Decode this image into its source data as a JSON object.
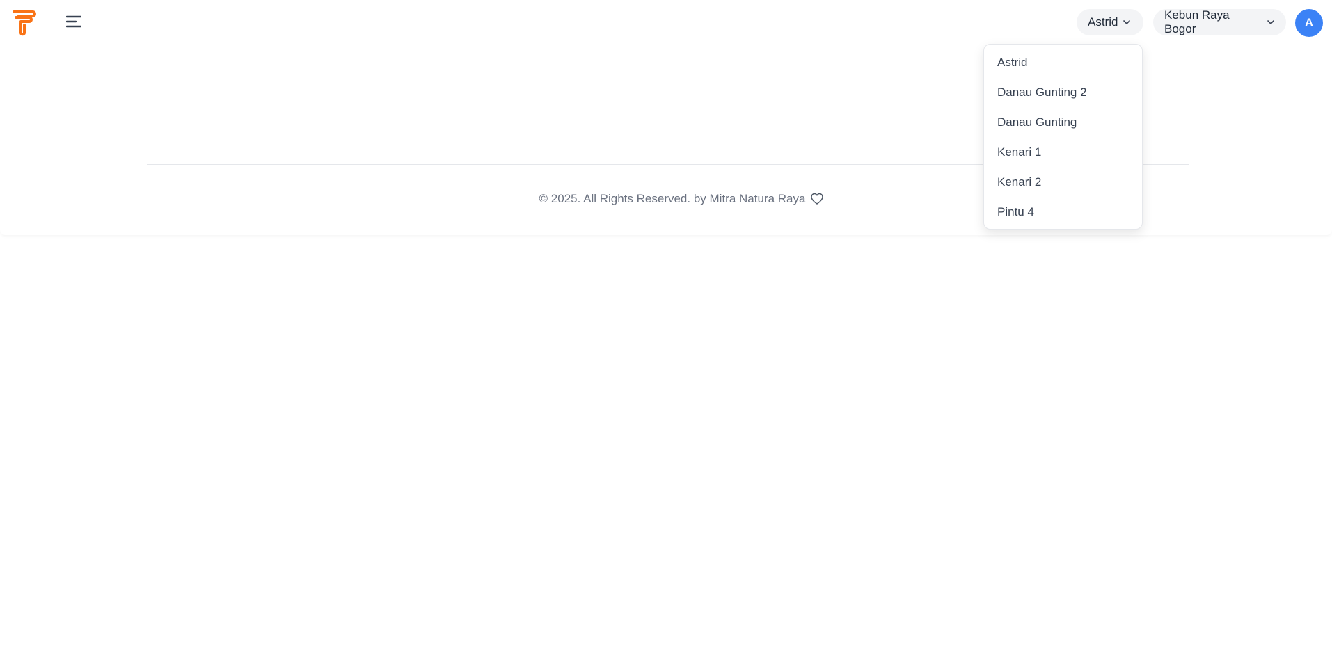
{
  "header": {
    "brand_color": "#f97316",
    "menu_icon": "hamburger-icon",
    "user_selector": {
      "label": "Astrid",
      "icon": "chevron-down-icon"
    },
    "location_selector": {
      "label": "Kebun Raya Bogor",
      "icon": "chevron-down-icon"
    },
    "avatar": {
      "initial": "A",
      "color": "#3b82f6"
    }
  },
  "dropdown": {
    "items": [
      {
        "label": "Astrid"
      },
      {
        "label": "Danau Gunting 2"
      },
      {
        "label": "Danau Gunting"
      },
      {
        "label": "Kenari 1"
      },
      {
        "label": "Kenari 2"
      },
      {
        "label": "Pintu 4"
      }
    ]
  },
  "footer": {
    "text": "© 2025. All Rights Reserved. by Mitra Natura Raya",
    "icon": "heart-icon"
  }
}
